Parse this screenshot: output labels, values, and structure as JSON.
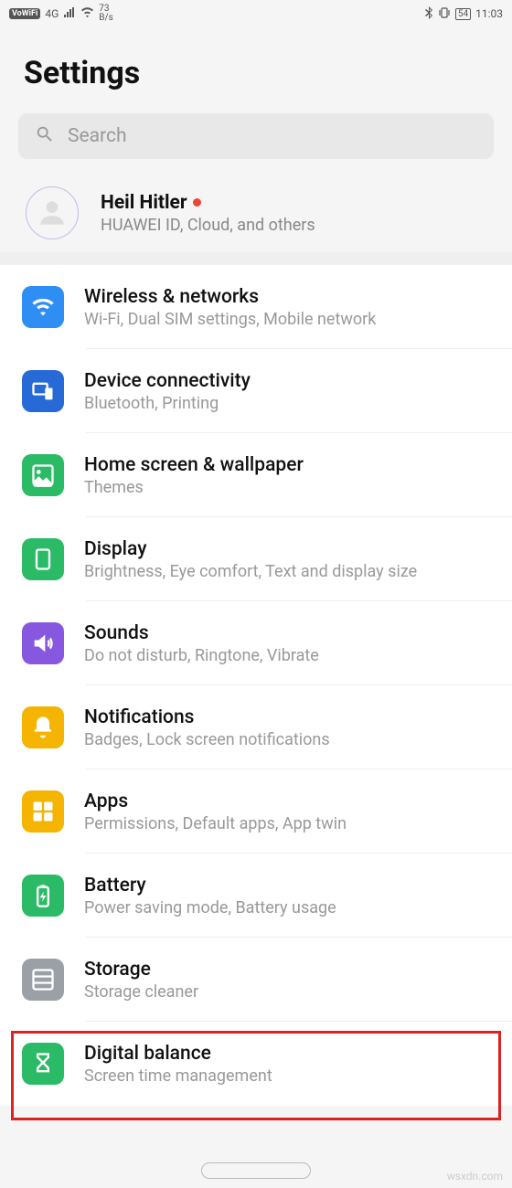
{
  "status": {
    "vowifi": "VoWiFi",
    "net": "4G",
    "datarate": "73",
    "datarate_unit": "B/s",
    "battery": "54",
    "time": "11:03"
  },
  "header": {
    "title": "Settings"
  },
  "search": {
    "placeholder": "Search"
  },
  "account": {
    "name": "Heil Hitler",
    "sub": "HUAWEI ID, Cloud, and others"
  },
  "rows": [
    {
      "title": "Wireless & networks",
      "sub": "Wi-Fi, Dual SIM settings, Mobile network",
      "color": "#2f8ef4",
      "icon": "wifi"
    },
    {
      "title": "Device connectivity",
      "sub": "Bluetooth, Printing",
      "color": "#2769d6",
      "icon": "devices"
    },
    {
      "title": "Home screen & wallpaper",
      "sub": "Themes",
      "color": "#2bbb66",
      "icon": "image"
    },
    {
      "title": "Display",
      "sub": "Brightness, Eye comfort, Text and display size",
      "color": "#2bbb66",
      "icon": "display"
    },
    {
      "title": "Sounds",
      "sub": "Do not disturb, Ringtone, Vibrate",
      "color": "#8857e0",
      "icon": "sound"
    },
    {
      "title": "Notifications",
      "sub": "Badges, Lock screen notifications",
      "color": "#f5b400",
      "icon": "bell"
    },
    {
      "title": "Apps",
      "sub": "Permissions, Default apps, App twin",
      "color": "#f5b400",
      "icon": "apps"
    },
    {
      "title": "Battery",
      "sub": "Power saving mode, Battery usage",
      "color": "#2bbb66",
      "icon": "battery"
    },
    {
      "title": "Storage",
      "sub": "Storage cleaner",
      "color": "#9aa0a6",
      "icon": "storage"
    },
    {
      "title": "Digital balance",
      "sub": "Screen time management",
      "color": "#2bbb66",
      "icon": "hourglass"
    }
  ],
  "highlight_index": 6,
  "watermark": "wsxdn.com"
}
